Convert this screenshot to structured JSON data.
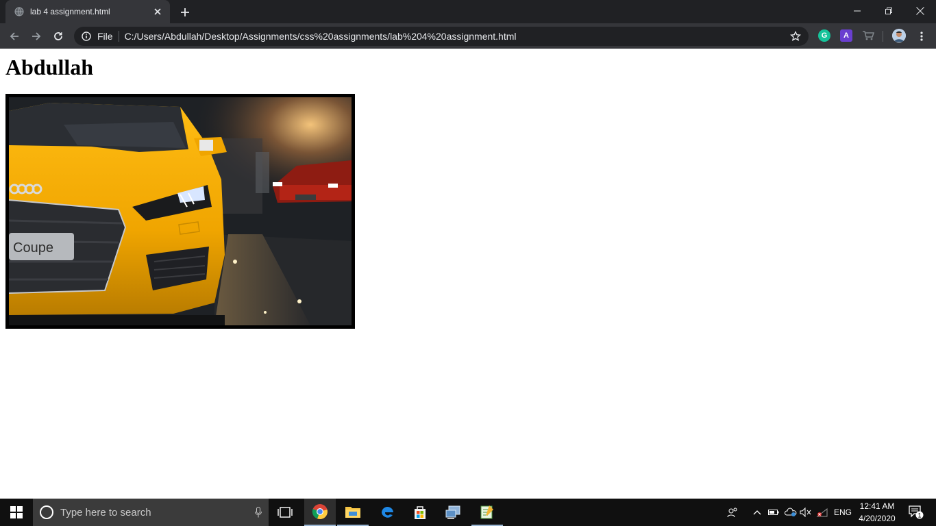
{
  "browser": {
    "tab_title": "lab 4 assignment.html",
    "new_tab_symbol": "+",
    "scheme_label": "File",
    "url": "C:/Users/Abdullah/Desktop/Assignments/css%20assignments/lab%204%20assignment.html"
  },
  "page": {
    "heading": "Abdullah",
    "image_plate_text": "Coupe"
  },
  "taskbar": {
    "search_placeholder": "Type here to search",
    "language": "ENG",
    "time": "12:41 AM",
    "date": "4/20/2020",
    "notification_count": "1"
  },
  "colors": {
    "tabstrip": "#202124",
    "toolbar": "#35363a",
    "car_yellow": "#f0a500",
    "taskbar": "#101010"
  },
  "icons": [
    "globe-icon",
    "close-icon",
    "plus-icon",
    "minimize-icon",
    "restore-icon",
    "back-icon",
    "forward-icon",
    "reload-icon",
    "info-icon",
    "star-icon",
    "grammarly-icon",
    "extension-a-icon",
    "cart-icon",
    "avatar",
    "menu-icon",
    "windows-icon",
    "cortana-icon",
    "mic-icon",
    "task-view-icon",
    "chrome-icon",
    "file-explorer-icon",
    "edge-icon",
    "store-icon",
    "network-app-icon",
    "notepad-icon",
    "people-icon",
    "chevron-up-icon",
    "battery-icon",
    "onedrive-icon",
    "speaker-muted-icon",
    "wifi-icon",
    "notification-icon"
  ]
}
